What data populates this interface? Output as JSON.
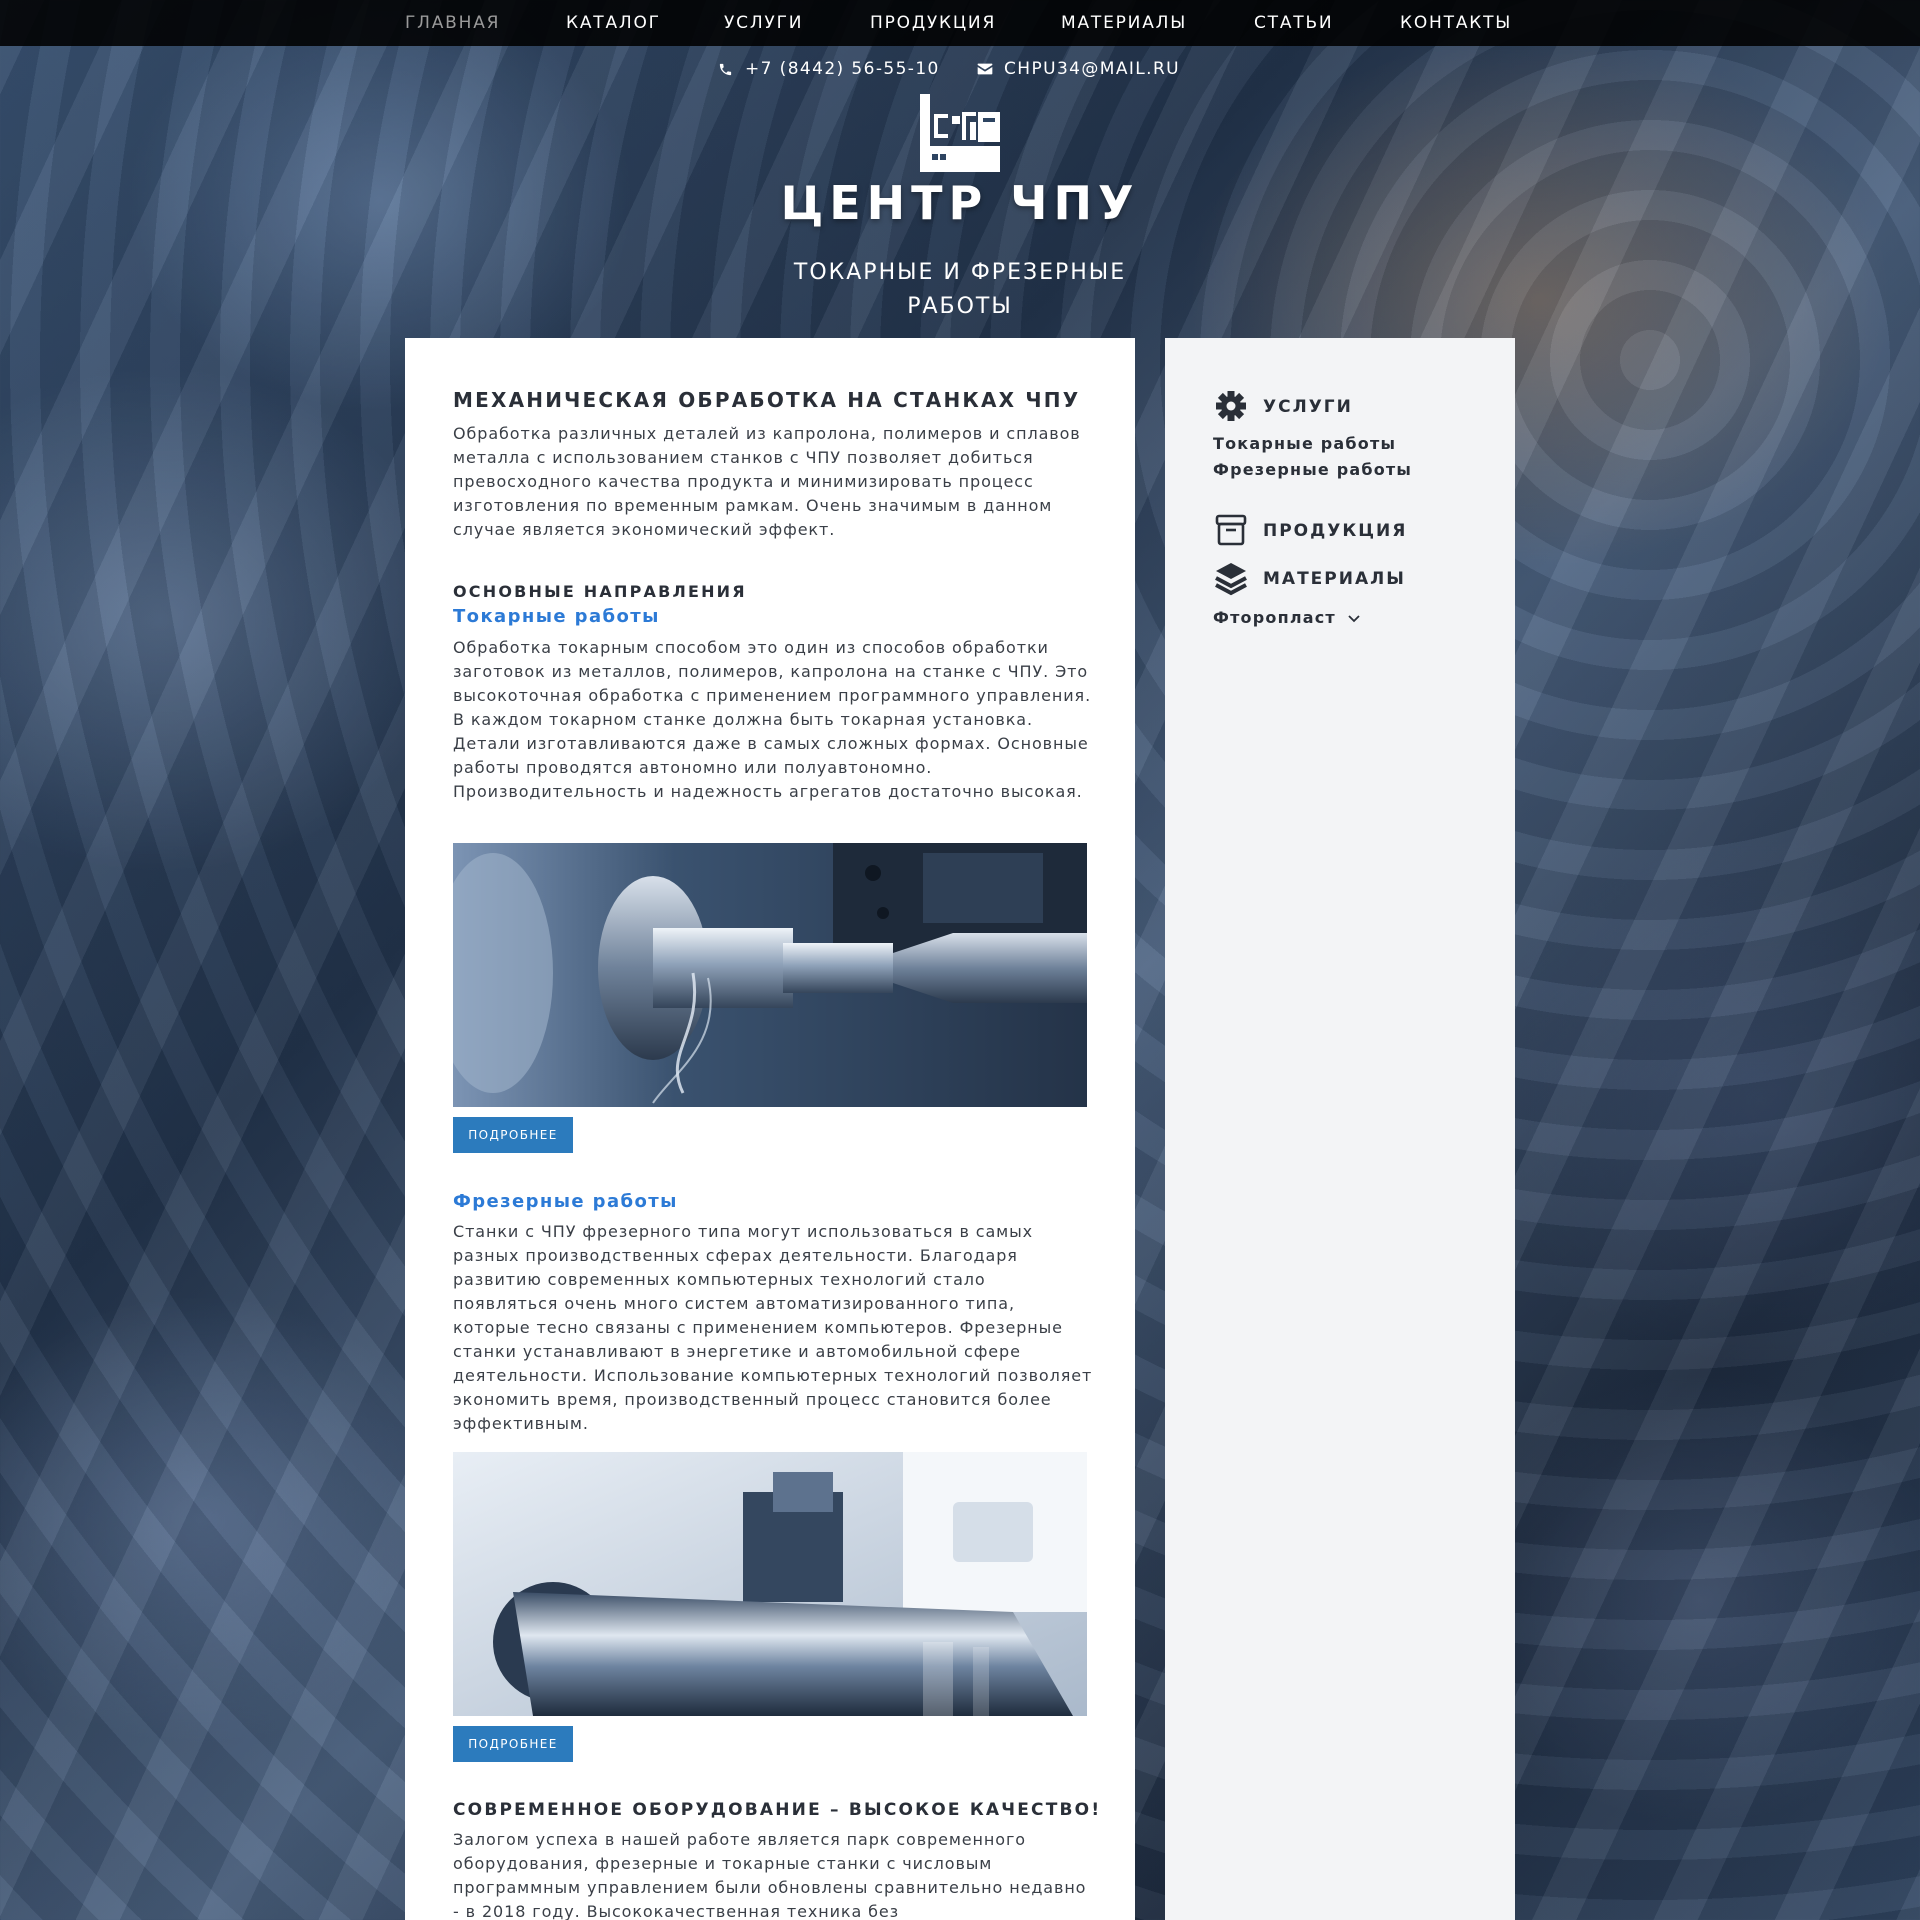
{
  "nav": {
    "items": [
      {
        "label": "ГЛАВНАЯ",
        "active": true
      },
      {
        "label": "КАТАЛОГ"
      },
      {
        "label": "УСЛУГИ"
      },
      {
        "label": "ПРОДУКЦИЯ"
      },
      {
        "label": "МАТЕРИАЛЫ"
      },
      {
        "label": "СТАТЬИ"
      },
      {
        "label": "КОНТАКТЫ"
      }
    ]
  },
  "contacts": {
    "phone": "+7 (8442) 56-55-10",
    "email": "CHPU34@MAIL.RU"
  },
  "header": {
    "title": "ЦЕНТР ЧПУ",
    "subtitle": "ТОКАРНЫЕ И ФРЕЗЕРНЫЕ РАБОТЫ"
  },
  "main": {
    "heading": "МЕХАНИЧЕСКАЯ ОБРАБОТКА НА СТАНКАХ ЧПУ",
    "intro": "Обработка различных деталей из капролона, полимеров и сплавов металла с использованием станков с ЧПУ позволяет добиться превосходного качества продукта и минимизировать процесс изготовления по временным рамкам. Очень значимым в данном случае является экономический эффект.",
    "directions_heading": "ОСНОВНЫЕ НАПРАВЛЕНИЯ",
    "turning": {
      "title": "Токарные работы",
      "text": "Обработка токарным способом это один из способов обработки заготовок из металлов, полимеров, капролона на станке с ЧПУ. Это высокоточная обработка с применением программного управления. В каждом токарном станке должна быть токарная установка. Детали изготавливаются даже в самых сложных формах. Основные работы проводятся автономно или полуавтономно. Производительность и надежность агрегатов достаточно высокая.",
      "button": "ПОДРОБНЕЕ"
    },
    "milling": {
      "title": "Фрезерные работы",
      "text": "Станки с ЧПУ фрезерного типа могут использоваться в самых разных производственных сферах деятельности. Благодаря развитию современных компьютерных технологий стало появляться очень много систем автоматизированного типа, которые тесно связаны с применением компьютеров. Фрезерные станки устанавливают в энергетике и автомобильной сфере деятельности. Использование компьютерных технологий позволяет экономить время, производственный процесс становится более эффективным.",
      "button": "ПОДРОБНЕЕ"
    },
    "equipment": {
      "heading": "СОВРЕМЕННОЕ ОБОРУДОВАНИЕ – ВЫСОКОЕ КАЧЕСТВО!",
      "text": "Залогом успеха в нашей работе является парк современного оборудования, фрезерные и токарные станки с числовым программным управлением были обновлены сравнительно недавно - в 2018 году. Высококачественная техника без"
    }
  },
  "sidebar": {
    "services": {
      "label": "УСЛУГИ",
      "icon": "gear-icon",
      "links": [
        "Токарные работы",
        "Фрезерные работы"
      ]
    },
    "products": {
      "label": "ПРОДУКЦИЯ",
      "icon": "archive-box-icon"
    },
    "materials": {
      "label": "МАТЕРИАЛЫ",
      "icon": "layers-icon",
      "dropdown": "Фторопласт"
    }
  },
  "colors": {
    "accent": "#2c7ad6",
    "button": "#2c7bbd",
    "nav_bg": "#000000",
    "heading": "#2a2f38"
  }
}
